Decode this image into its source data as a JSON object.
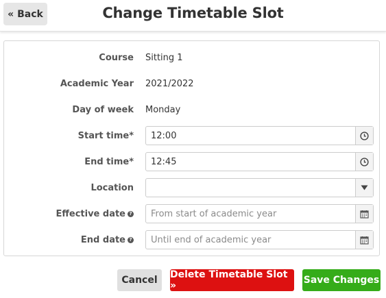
{
  "header": {
    "back_label": "« Back",
    "title": "Change Timetable Slot"
  },
  "form": {
    "course": {
      "label": "Course",
      "value": "Sitting 1"
    },
    "academic_year": {
      "label": "Academic Year",
      "value": "2021/2022"
    },
    "day_of_week": {
      "label": "Day of week",
      "value": "Monday"
    },
    "start_time": {
      "label": "Start time*",
      "value": "12:00",
      "icon": "clock-icon"
    },
    "end_time": {
      "label": "End time*",
      "value": "12:45",
      "icon": "clock-icon"
    },
    "location": {
      "label": "Location",
      "value": "",
      "icon": "dropdown-arrow-icon"
    },
    "effective_date": {
      "label": "Effective date",
      "placeholder": "From start of academic year",
      "help_icon": "help-icon",
      "icon": "calendar-icon"
    },
    "end_date": {
      "label": "End date",
      "placeholder": "Until end of academic year",
      "help_icon": "help-icon",
      "icon": "calendar-icon"
    }
  },
  "actions": {
    "cancel_label": "Cancel",
    "delete_label": "Delete Timetable Slot »",
    "save_label": "Save Changes"
  },
  "colors": {
    "delete": "#dd1111",
    "save": "#35ac19",
    "cancel": "#e0e0e0",
    "back": "#e6e6e6"
  }
}
